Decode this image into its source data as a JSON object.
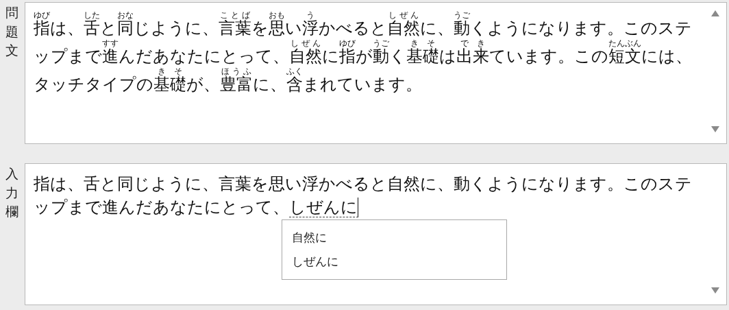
{
  "question": {
    "label": "問題文",
    "lines": [
      [
        {
          "text": "指",
          "ruby": "ゆび"
        },
        {
          "text": "は、"
        },
        {
          "text": "舌",
          "ruby": "した"
        },
        {
          "text": "と"
        },
        {
          "text": "同",
          "ruby": "おな"
        },
        {
          "text": "じように、"
        },
        {
          "text": "言葉",
          "ruby": "ことば"
        },
        {
          "text": "を"
        },
        {
          "text": "思",
          "ruby": "おも"
        },
        {
          "text": "い"
        },
        {
          "text": "浮",
          "ruby": "う"
        },
        {
          "text": "かべると"
        },
        {
          "text": "自然",
          "ruby": "しぜん"
        },
        {
          "text": "に、"
        },
        {
          "text": "動",
          "ruby": "うご"
        },
        {
          "text": "くようになります。このステ"
        }
      ],
      [
        {
          "text": "ップまで"
        },
        {
          "text": "進",
          "ruby": "すす"
        },
        {
          "text": "んだあなたにとって、"
        },
        {
          "text": "自然",
          "ruby": "しぜん"
        },
        {
          "text": "に"
        },
        {
          "text": "指",
          "ruby": "ゆび"
        },
        {
          "text": "が"
        },
        {
          "text": "動",
          "ruby": "うご"
        },
        {
          "text": "く"
        },
        {
          "text": "基礎",
          "ruby": "きそ"
        },
        {
          "text": "は"
        },
        {
          "text": "出来",
          "ruby": "でき"
        },
        {
          "text": "ています。この"
        },
        {
          "text": "短文",
          "ruby": "たんぶん"
        },
        {
          "text": "には、"
        }
      ],
      [
        {
          "text": "タッチタイプの"
        },
        {
          "text": "基礎",
          "ruby": "きそ"
        },
        {
          "text": "が、"
        },
        {
          "text": "豊富",
          "ruby": "ほうふ"
        },
        {
          "text": "に、"
        },
        {
          "text": "含",
          "ruby": "ふく"
        },
        {
          "text": "まれています。"
        }
      ]
    ]
  },
  "input": {
    "label": "入力欄",
    "lines": [
      "指は、舌と同じように、言葉を思い浮かべると自然に、動くようになります。このステ",
      "ップまで進んだあなたにとって、"
    ],
    "composition": "しぜんに",
    "candidates": [
      "自然に",
      "しぜんに"
    ]
  }
}
